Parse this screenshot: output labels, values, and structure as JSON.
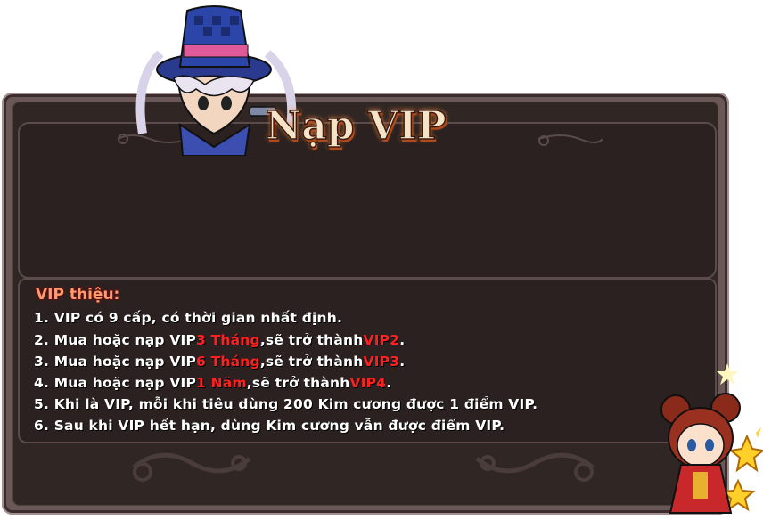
{
  "dialog": {
    "title": "Nạp VIP"
  },
  "info": {
    "heading": "VIP thiệu:",
    "lines": [
      {
        "number": "1.",
        "text": "VIP có 9 cấp, có thời gian nhất định."
      },
      {
        "number": "2.",
        "pre": "Mua hoặc nạp VIP",
        "highlight1": "3 Tháng",
        "mid": ",sẽ trở thành",
        "highlight2": "VIP2",
        "post": "."
      },
      {
        "number": "3.",
        "pre": "Mua hoặc nạp VIP",
        "highlight1": "6 Tháng",
        "mid": ",sẽ trở thành",
        "highlight2": "VIP3",
        "post": "."
      },
      {
        "number": "4.",
        "pre": "Mua hoặc nạp VIP",
        "highlight1": "1 Năm",
        "mid": ",sẽ trở thành",
        "highlight2": "VIP4",
        "post": "."
      },
      {
        "number": "5.",
        "text": "Khi là VIP, mỗi khi tiêu dùng 200 Kim cương được 1 điểm VIP."
      },
      {
        "number": "6.",
        "text": "Sau khi VIP hết hạn, dùng Kim cương vẫn được điểm VIP."
      }
    ]
  },
  "colors": {
    "frame": "#6a5857",
    "panel": "#2a2120",
    "heading": "#ff9b6e",
    "highlight": "#ff2020",
    "text": "#ffffff"
  },
  "decorations": {
    "mascot_left": "hat-character-icon",
    "mascot_right": "girl-character-icon"
  }
}
